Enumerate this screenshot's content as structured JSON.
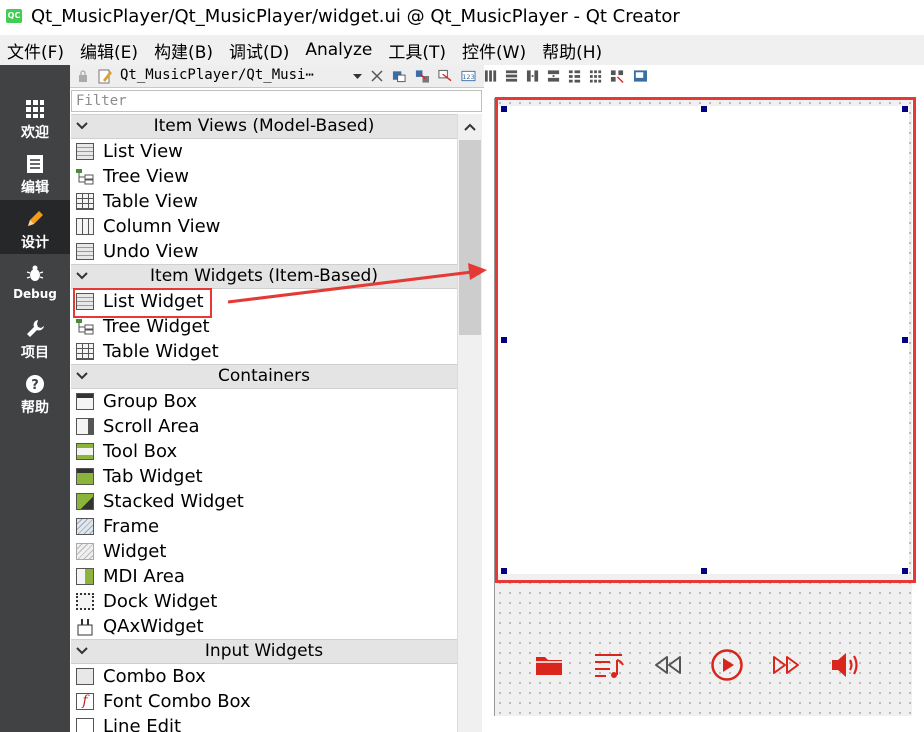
{
  "window": {
    "title": "Qt_MusicPlayer/Qt_MusicPlayer/widget.ui @ Qt_MusicPlayer - Qt Creator",
    "icon_text": "QC"
  },
  "menu": [
    "文件(F)",
    "编辑(E)",
    "构建(B)",
    "调试(D)",
    "Analyze",
    "工具(T)",
    "控件(W)",
    "帮助(H)"
  ],
  "modes": [
    {
      "label": "欢迎",
      "icon": "grid-icon"
    },
    {
      "label": "编辑",
      "icon": "document-icon"
    },
    {
      "label": "设计",
      "icon": "pencil-icon",
      "active": true
    },
    {
      "label": "Debug",
      "icon": "bug-icon"
    },
    {
      "label": "项目",
      "icon": "wrench-icon"
    },
    {
      "label": "帮助",
      "icon": "help-icon"
    }
  ],
  "editor_toolbar": {
    "file": "Qt_MusicPlayer/Qt_Musi⋯"
  },
  "filter_placeholder": "Filter",
  "widget_box": {
    "item_views": {
      "title": "Item Views (Model-Based)",
      "items": [
        "List View",
        "Tree View",
        "Table View",
        "Column View",
        "Undo View"
      ]
    },
    "item_widgets": {
      "title": "Item Widgets (Item-Based)",
      "items": [
        "List Widget",
        "Tree Widget",
        "Table Widget"
      ]
    },
    "containers": {
      "title": "Containers",
      "items": [
        "Group Box",
        "Scroll Area",
        "Tool Box",
        "Tab Widget",
        "Stacked Widget",
        "Frame",
        "Widget",
        "MDI Area",
        "Dock Widget",
        "QAxWidget"
      ]
    },
    "input_widgets": {
      "title": "Input Widgets",
      "items": [
        "Combo Box",
        "Font Combo Box",
        "Line Edit"
      ]
    }
  },
  "player_controls": [
    "folder-icon",
    "playlist-icon",
    "previous-icon",
    "play-icon",
    "next-icon",
    "volume-icon"
  ],
  "colors": {
    "accent_red": "#e53935",
    "player_red": "#d9251c",
    "mode_bar": "#404244",
    "mode_active": "#262728"
  }
}
